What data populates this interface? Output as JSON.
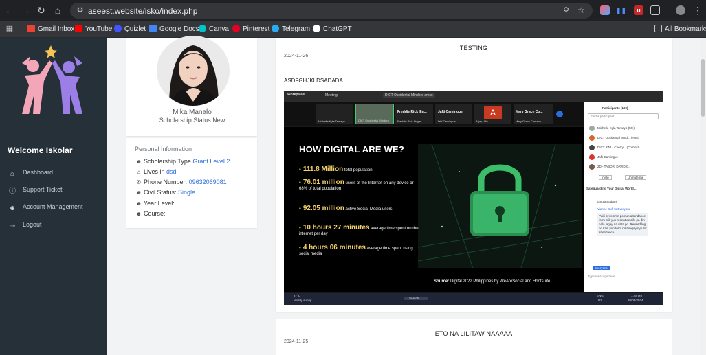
{
  "browser": {
    "url": "aseest.website/isko/index.php",
    "bookmarks": [
      {
        "label": "Gmail Inbox",
        "color": "#ea4335"
      },
      {
        "label": "YouTube",
        "color": "#ff0000"
      },
      {
        "label": "Quizlet",
        "color": "#4255ff"
      },
      {
        "label": "Google Docs",
        "color": "#4285f4"
      },
      {
        "label": "Canva",
        "color": "#00c4cc"
      },
      {
        "label": "Pinterest",
        "color": "#e60023"
      },
      {
        "label": "Telegram",
        "color": "#2aabee"
      },
      {
        "label": "ChatGPT",
        "color": "#ffffff"
      }
    ],
    "all_bookmarks": "All Bookmarks"
  },
  "sidebar": {
    "welcome": "Welcome Iskolar",
    "items": [
      {
        "label": "Dashboard",
        "icon": "home-icon"
      },
      {
        "label": "Support Ticket",
        "icon": "question-circle-icon"
      },
      {
        "label": "Account Management",
        "icon": "user-icon"
      },
      {
        "label": "Logout",
        "icon": "logout-icon"
      }
    ]
  },
  "profile": {
    "name": "Mika Manalo",
    "status": "Scholarship Status New",
    "info_title": "Personal Information",
    "rows": [
      {
        "label": "Scholarship Type",
        "value": "Grant Level 2",
        "link": true,
        "icon": "user-icon"
      },
      {
        "label": "Lives in",
        "value": "dsd",
        "link": true,
        "icon": "home-icon"
      },
      {
        "label": "Phone Number:",
        "value": "09632069081",
        "link": true,
        "icon": "phone-icon"
      },
      {
        "label": "Civil Status:",
        "value": "Single",
        "link": true,
        "icon": "user-icon"
      },
      {
        "label": "Year Level:",
        "value": "",
        "link": false,
        "icon": "user-icon"
      },
      {
        "label": "Course:",
        "value": "",
        "link": false,
        "icon": "user-icon"
      }
    ]
  },
  "posts": [
    {
      "title": "TESTING",
      "date": "2024-11-26",
      "body": "ASDFGHJKLDSADADA",
      "screenshot": {
        "app": "Workplace",
        "meeting": "Meeting",
        "meeting_banner": "DICT Occidental Mindoro amco",
        "tiles": [
          {
            "label": "Michelle Kyla Tamayo"
          },
          {
            "label": "DICT Occidental Mindoro"
          },
          {
            "label": "Freddie Rick Ilin...",
            "sub": "Freddie Rick Ilingan"
          },
          {
            "label": "Jafti Camingue",
            "sub": "Jafti Camingue"
          },
          {
            "label": "A",
            "sub": "Arjay Villa"
          },
          {
            "label": "Mary Grace Co...",
            "sub": "Mary Grace Comaoo"
          }
        ],
        "slide_title": "HOW DIGITAL ARE WE?",
        "stats": [
          {
            "big": "111.8 Million",
            "text": "total population"
          },
          {
            "big": "76.01 million",
            "text": "users of the Internet on any device or 68% of total population"
          },
          {
            "big": "92.05 million",
            "text": "active Social Media users"
          },
          {
            "big": "10 hours 27 minutes",
            "text": "average time spent on the internet per day"
          },
          {
            "big": "4 hours 06 minutes",
            "text": "average time spent using social media"
          }
        ],
        "source_label": "Source:",
        "source_text": "Digital 2022 Philippines by WeAreSocial and Hootsuite",
        "panel": {
          "participants_title": "Participants (100)",
          "find": "Find a participant",
          "people": [
            "Michelle Kyla Tamayo (Me)",
            "DICT Occidental Mind... (Host)",
            "DICT R4B - Cherry... (Co-host)",
            "Jafti Camingue",
            "2D - TABOR, DAVID G."
          ],
          "invite": "Invite",
          "unmute": "Unmute me",
          "chat_title": "Safeguarding Your Digital World...",
          "msg1": "omg ang dami",
          "msg2_from": "Vianne Buff to Everyone",
          "msg2": "Paki ayos nmn po nun attendance form still yun recent details pa din nala lagay na data po. Reused lng po kasi yun form na binigay nyo for attendance",
          "to": "Everyone",
          "type_msg": "Type message here..."
        },
        "taskbar": {
          "weather": "27°C",
          "weather_sub": "Mostly sunny",
          "search": "Search",
          "lang": "ENG",
          "region": "US",
          "time": "1:48 pm",
          "date": "20/09/2024"
        }
      }
    },
    {
      "title": "ETO NA LILITAW NAAAAA",
      "date": "2024-11-25"
    }
  ],
  "colors": {
    "sidebar_bg": "#263039",
    "link": "#2f6fdb",
    "slide_accent": "#f4d06a"
  }
}
